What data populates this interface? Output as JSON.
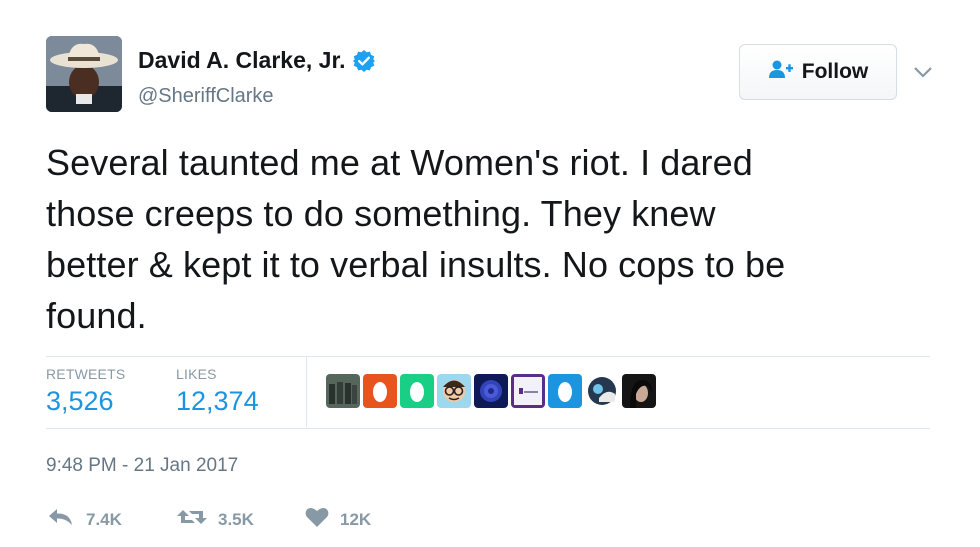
{
  "user": {
    "name": "David A. Clarke, Jr.",
    "handle": "@SheriffClarke"
  },
  "follow_button": {
    "label": "Follow"
  },
  "tweet": {
    "lines": [
      "Several taunted me at Women's riot. I dared",
      "those creeps to do something. They knew",
      "better & kept it to verbal insults. No cops to be",
      "found."
    ]
  },
  "stats": {
    "retweets_label": "RETWEETS",
    "retweets_value": "3,526",
    "likes_label": "LIKES",
    "likes_value": "12,374"
  },
  "liker_avatars": [
    {
      "icon": "group-photo-avatar",
      "bg": "#4a5a4a"
    },
    {
      "icon": "egg-avatar",
      "bg": "#e8541e"
    },
    {
      "icon": "egg-avatar",
      "bg": "#19cf86"
    },
    {
      "icon": "glasses-man-avatar",
      "bg": "#8fd0e8"
    },
    {
      "icon": "blue-rose-avatar",
      "bg": "#1d2a8a"
    },
    {
      "icon": "logo-avatar",
      "bg": "#e9e6f5"
    },
    {
      "icon": "egg-avatar",
      "bg": "#1b95e0"
    },
    {
      "icon": "cartoon-avatar",
      "bg": "#2a3a55"
    },
    {
      "icon": "dark-hair-avatar",
      "bg": "#1a1a1a"
    }
  ],
  "timestamp": "9:48 PM - 21 Jan 2017",
  "actions": {
    "reply_count": "7.4K",
    "retweet_count": "3.5K",
    "like_count": "12K"
  },
  "colors": {
    "accent": "#1b95e0",
    "muted": "#657786",
    "text": "#14171a"
  }
}
